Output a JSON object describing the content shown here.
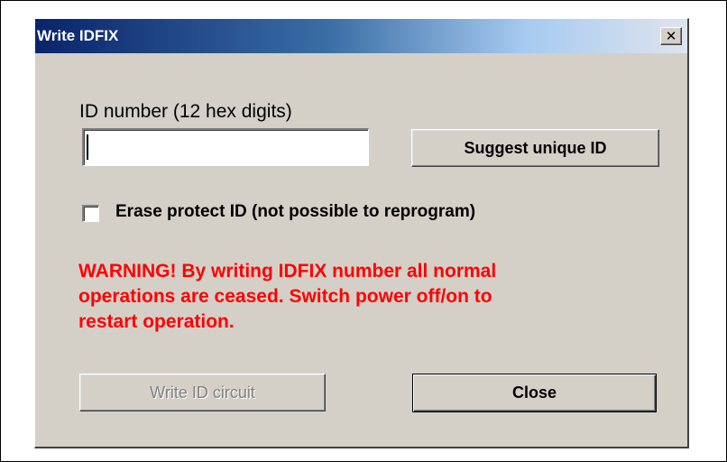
{
  "window": {
    "title": "Write IDFIX",
    "close_glyph": "✕"
  },
  "form": {
    "id_label": "ID number (12 hex digits)",
    "id_value": "",
    "id_placeholder": "",
    "suggest_button": "Suggest unique ID",
    "erase_protect_label": "Erase protect ID (not possible to reprogram)",
    "erase_protect_checked": false
  },
  "warning": {
    "lines": [
      "WARNING! By writing IDFIX number all normal",
      "operations are ceased. Switch power off/on to",
      "restart operation."
    ],
    "color": "#ff0000"
  },
  "buttons": {
    "write": "Write ID circuit",
    "write_enabled": false,
    "close": "Close"
  },
  "colors": {
    "dialog_bg": "#d4d0c8",
    "titlebar_start": "#0a246a",
    "titlebar_end": "#a6caf0"
  }
}
